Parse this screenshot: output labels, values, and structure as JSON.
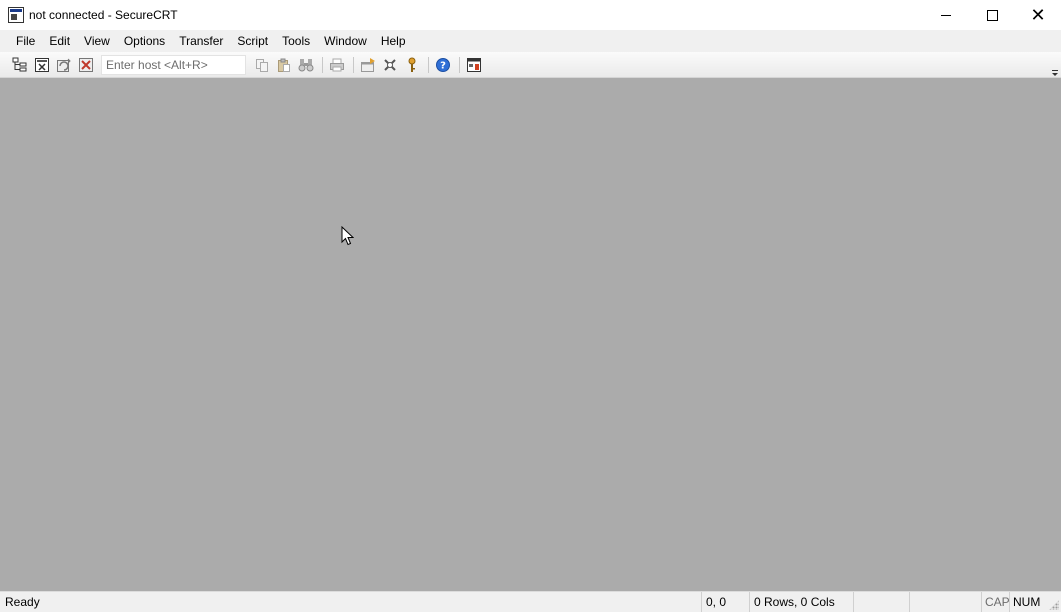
{
  "window": {
    "title": "not connected - SecureCRT",
    "controls": [
      "minimize",
      "maximize",
      "close"
    ]
  },
  "menu": {
    "items": [
      "File",
      "Edit",
      "View",
      "Options",
      "Transfer",
      "Script",
      "Tools",
      "Window",
      "Help"
    ]
  },
  "toolbar": {
    "buttons_group1": [
      "connect-icon",
      "quick-connect-icon",
      "reconnect-icon",
      "disconnect-icon"
    ],
    "host_placeholder": "Enter host <Alt+R>",
    "buttons_group2": [
      "copy-icon",
      "paste-icon",
      "find-icon"
    ],
    "buttons_group3": [
      "print-icon"
    ],
    "buttons_group4": [
      "session-options-icon",
      "global-options-icon",
      "keymap-icon"
    ],
    "buttons_group5": [
      "help-icon"
    ],
    "buttons_group6": [
      "sftp-icon"
    ]
  },
  "status": {
    "state": "Ready",
    "cursor_pos": "0, 0",
    "dimensions": "0 Rows, 0 Cols",
    "cap": "CAP",
    "num": "NUM"
  },
  "colors": {
    "workspace": "#ababab",
    "chrome": "#f0f0f0",
    "help_accent": "#2f6fd6"
  }
}
